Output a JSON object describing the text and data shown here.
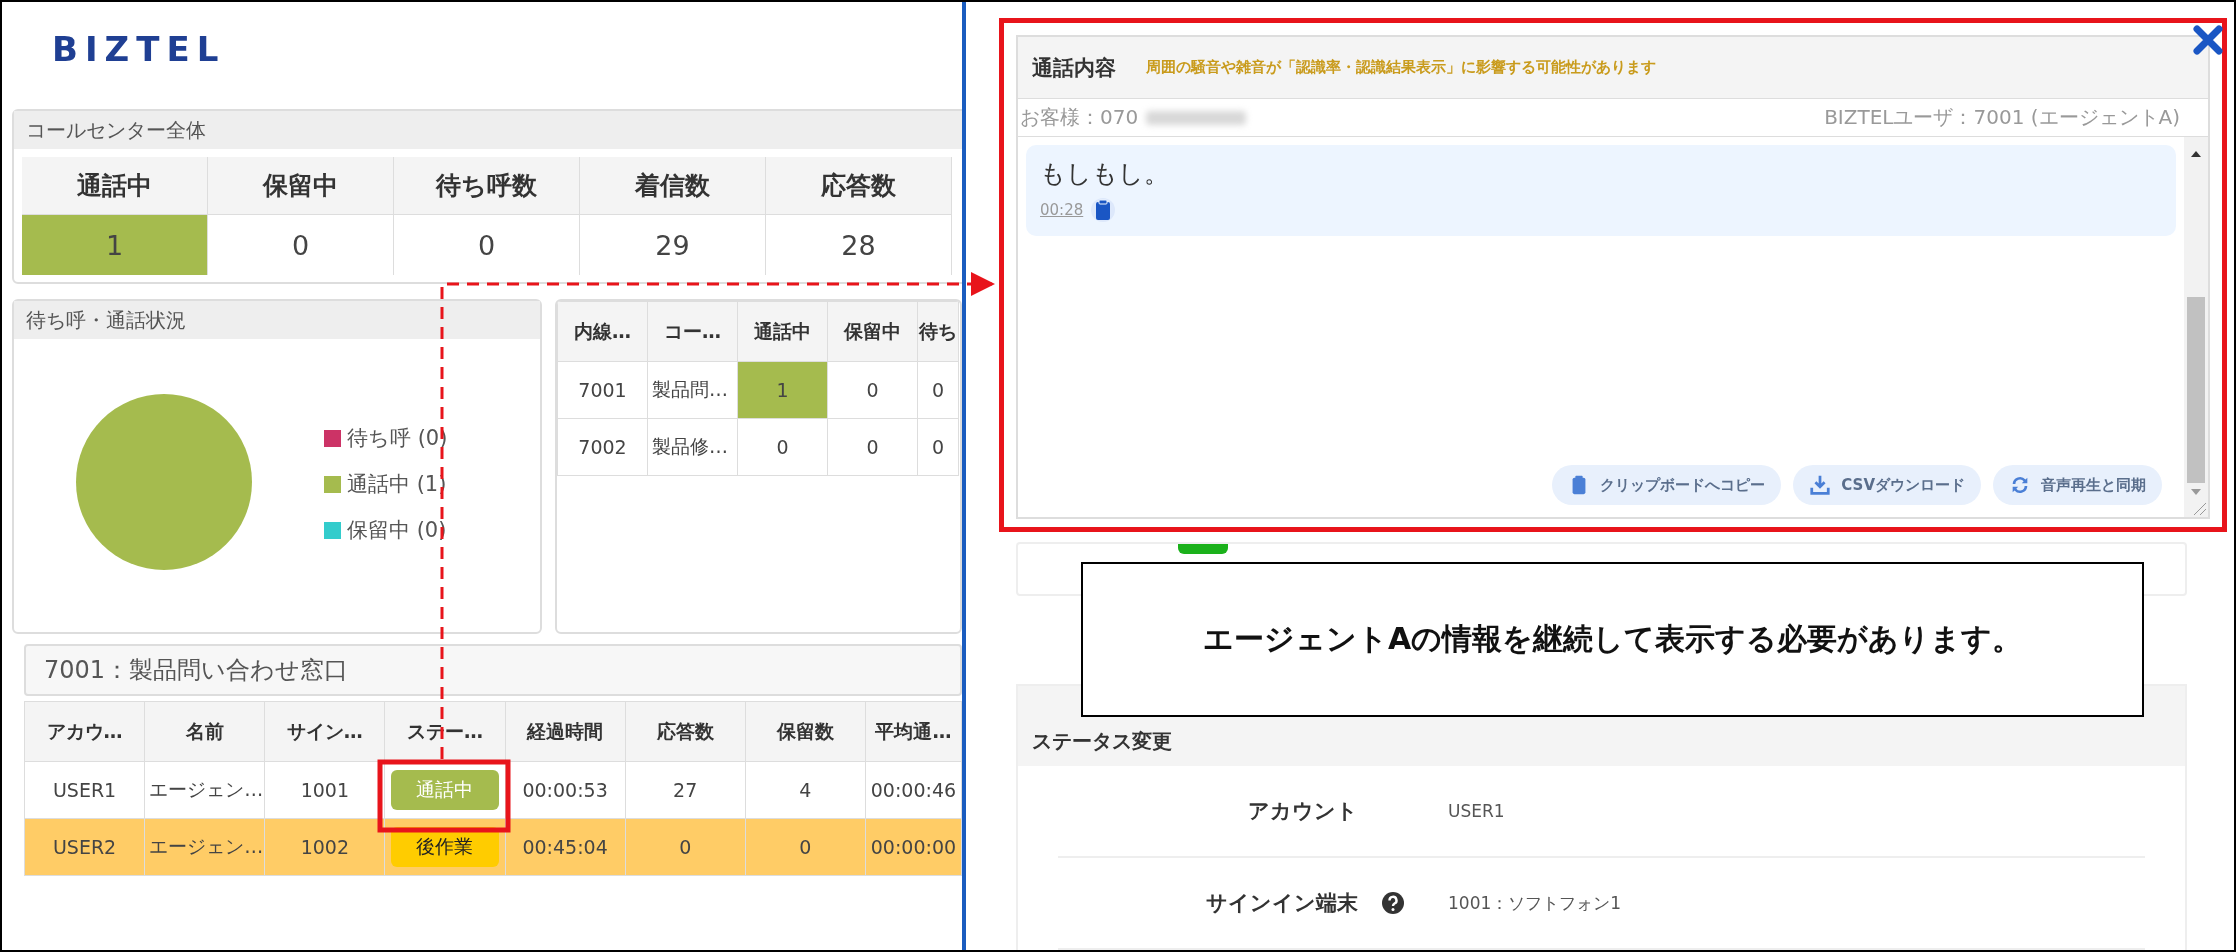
{
  "logo": {
    "text": "BIZTEL"
  },
  "call_center": {
    "title": "コールセンター全体",
    "columns": [
      {
        "label": "通話中",
        "value": "1",
        "highlighted": true
      },
      {
        "label": "保留中",
        "value": "0",
        "highlighted": false
      },
      {
        "label": "待ち呼数",
        "value": "0",
        "highlighted": false
      },
      {
        "label": "着信数",
        "value": "29",
        "highlighted": false
      },
      {
        "label": "応答数",
        "value": "28",
        "highlighted": false
      }
    ]
  },
  "queue_chart": {
    "title": "待ち呼・通話状況",
    "chart_data": {
      "type": "pie",
      "categories": [
        "待ち呼 (0)",
        "通話中 (1)",
        "保留中 (0)"
      ],
      "values": [
        0,
        1,
        0
      ]
    },
    "legend": [
      {
        "color": "#cc3366"
      },
      {
        "color": "#a5bb4e"
      },
      {
        "color": "#33cccc"
      }
    ]
  },
  "extensions": {
    "columns": [
      "内線…",
      "コー…",
      "通話中",
      "保留中",
      "待ち"
    ],
    "rows": [
      {
        "cells": [
          {
            "text": "7001",
            "highlighted": false
          },
          {
            "text": "製品問…",
            "highlighted": false
          },
          {
            "text": "1",
            "highlighted": true
          },
          {
            "text": "0",
            "highlighted": false
          },
          {
            "text": "0",
            "highlighted": false
          }
        ]
      },
      {
        "cells": [
          {
            "text": "7002",
            "highlighted": false
          },
          {
            "text": "製品修…",
            "highlighted": false
          },
          {
            "text": "0",
            "highlighted": false
          },
          {
            "text": "0",
            "highlighted": false
          },
          {
            "text": "0",
            "highlighted": false
          }
        ]
      }
    ]
  },
  "queue": {
    "title": "7001：製品問い合わせ窓口",
    "columns": [
      "アカウ…",
      "名前",
      "サイン…",
      "ステー…",
      "経過時間",
      "応答数",
      "保留数",
      "平均通…"
    ],
    "rows": [
      {
        "highlighted": false,
        "account": "USER1",
        "name": "エージェン…",
        "terminal": "1001",
        "status": {
          "label": "通話中",
          "kind": "talking"
        },
        "elapsed": "00:00:53",
        "answered": "27",
        "held": "4",
        "average": "00:00:46"
      },
      {
        "highlighted": true,
        "account": "USER2",
        "name": "エージェン…",
        "terminal": "1002",
        "status": {
          "label": "後作業",
          "kind": "wrapup"
        },
        "elapsed": "00:45:04",
        "answered": "0",
        "held": "0",
        "average": "00:00:00"
      }
    ]
  },
  "transcript": {
    "title": "通話内容",
    "warning": "周囲の騒音や雑音が「認識率・認識結果表示」に影響する可能性があります",
    "customer_label": "お客様：070",
    "user_label": "BIZTELユーザ：7001 (エージェントA)",
    "messages": [
      {
        "text": "もしもし。",
        "time": "00:28"
      }
    ],
    "buttons": [
      {
        "label": "クリップボードへコピー"
      },
      {
        "label": "CSVダウンロード"
      },
      {
        "label": "音声再生と同期"
      }
    ]
  },
  "callout": {
    "text": "エージェントAの情報を継続して表示する必要があります。"
  },
  "status_change": {
    "title": "ステータス変更",
    "fields": [
      {
        "label": "アカウント",
        "value": "USER1",
        "help": false
      },
      {
        "label": "サインイン端末",
        "value": "1001：ソフトフォン1",
        "help": true
      }
    ]
  }
}
